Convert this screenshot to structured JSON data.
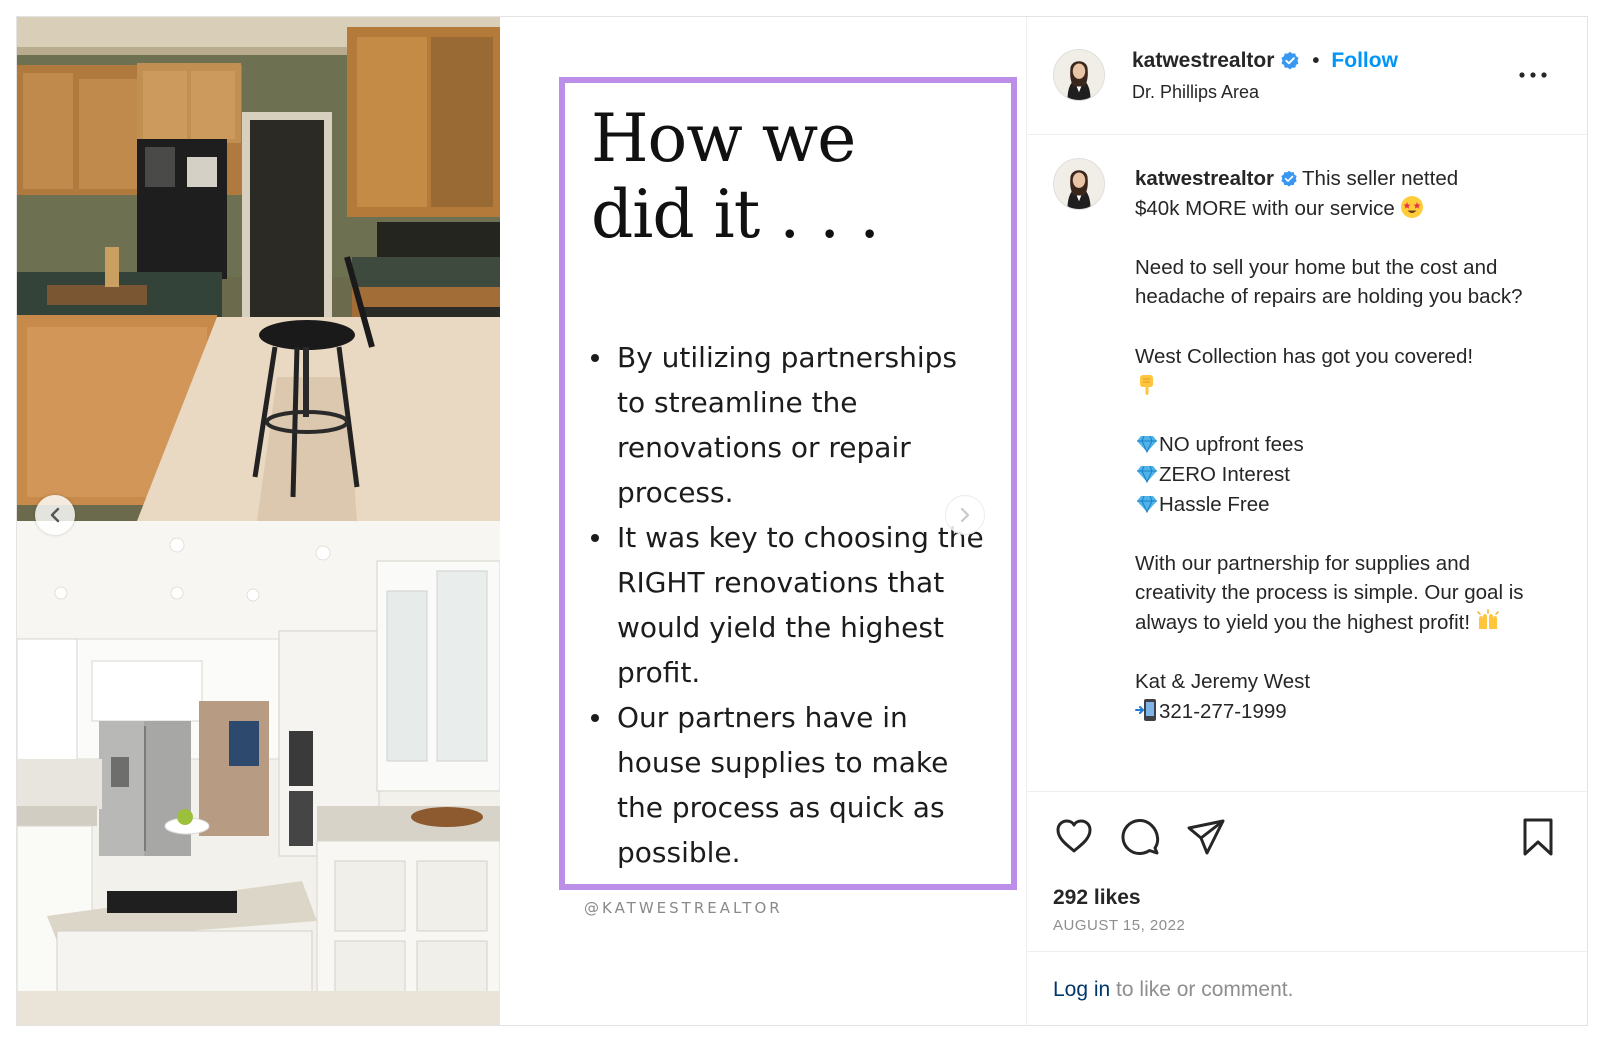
{
  "post": {
    "username": "katwestrealtor",
    "verified": true,
    "follow_label": "Follow",
    "separator": "•",
    "location": "Dr. Phillips Area",
    "more_icon": "more-horizontal-icon"
  },
  "slide": {
    "title_line1": "How we",
    "title_line2": "did it . . .",
    "bullets": [
      "By utilizing partnerships to streamline the renovations or repair process.",
      "It was key to choosing the RIGHT renovations that would yield the highest profit.",
      "Our partners have in house supplies to make the process as quick as possible."
    ],
    "handle": "@KATWESTREALTOR",
    "border_color": "#bb8fe8",
    "images": [
      "kitchen-before-photo",
      "kitchen-after-photo"
    ]
  },
  "carousel": {
    "prev_icon": "chevron-left-icon",
    "next_icon": "chevron-right-icon"
  },
  "caption": {
    "username": "katwestrealtor",
    "line1": "This seller netted",
    "line2": "$40k MORE with our service",
    "para2": "Need to sell your home but the cost and headache of repairs are holding you back?",
    "para3": "West Collection has got you covered!",
    "features": [
      "NO upfront fees",
      "ZERO Interest",
      "Hassle Free"
    ],
    "para5": "With our partnership for supplies and creativity the process is simple. Our goal is always to yield you the highest profit!",
    "signature": "Kat & Jeremy West",
    "phone": "321-277-1999",
    "emojis": [
      "star-struck-emoji",
      "pointing-down-emoji",
      "gem-emoji",
      "raised-hands-emoji",
      "mobile-phone-arrow-emoji"
    ]
  },
  "actions": {
    "icons": [
      "heart-icon",
      "comment-icon",
      "share-icon",
      "bookmark-icon"
    ],
    "likes": "292 likes",
    "date": "AUGUST 15, 2022"
  },
  "login": {
    "link": "Log in",
    "text": " to like or comment."
  },
  "colors": {
    "link_blue": "#0095f6",
    "verified_blue": "#3897f0",
    "login_link": "#00376b",
    "muted": "#8e8e8e"
  }
}
